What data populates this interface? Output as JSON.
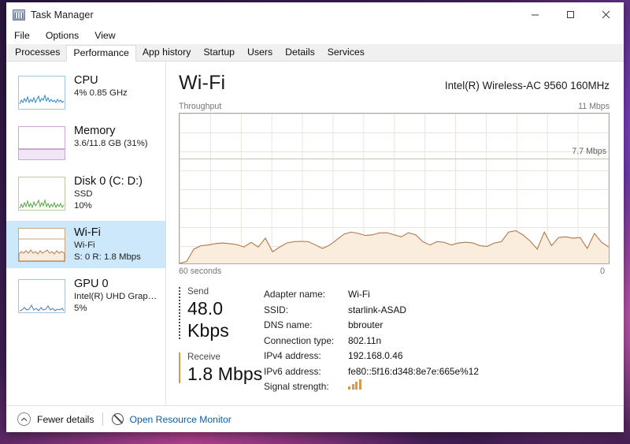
{
  "window": {
    "title": "Task Manager",
    "icon": "task-manager-icon",
    "controls": {
      "minimize": "minimize-icon",
      "maximize": "maximize-icon",
      "close": "close-icon"
    }
  },
  "menu": {
    "items": [
      "File",
      "Options",
      "View"
    ]
  },
  "tabs": {
    "active": "Performance",
    "items": [
      "Processes",
      "Performance",
      "App history",
      "Startup",
      "Users",
      "Details",
      "Services"
    ]
  },
  "sidebar": {
    "items": [
      {
        "title": "CPU",
        "sub1": "4%  0.85 GHz",
        "sub2": "",
        "color": "#1f7fc4",
        "selected": false
      },
      {
        "title": "Memory",
        "sub1": "3.6/11.8 GB (31%)",
        "sub2": "",
        "color": "#a55fa5",
        "selected": false
      },
      {
        "title": "Disk 0 (C: D:)",
        "sub1": "SSD",
        "sub2": "10%",
        "color": "#4a9d3f",
        "selected": false
      },
      {
        "title": "Wi-Fi",
        "sub1": "Wi-Fi",
        "sub2": "S: 0 R: 1.8 Mbps",
        "color": "#c8803a",
        "selected": true
      },
      {
        "title": "GPU 0",
        "sub1": "Intel(R) UHD Graphics ...",
        "sub2": "5%",
        "color": "#3b7cb5",
        "selected": false
      }
    ]
  },
  "main": {
    "title": "Wi-Fi",
    "adapter": "Intel(R) Wireless-AC 9560 160MHz",
    "graph_caption": "Throughput",
    "scale_max": "11 Mbps",
    "peak_label": "7.7 Mbps",
    "time_left": "60 seconds",
    "time_right": "0"
  },
  "rates": {
    "send": {
      "label": "Send",
      "value": "48.0 Kbps"
    },
    "receive": {
      "label": "Receive",
      "value": "1.8 Mbps"
    }
  },
  "details": {
    "rows": [
      {
        "key": "Adapter name:",
        "value": "Wi-Fi"
      },
      {
        "key": "SSID:",
        "value": "starlink-ASAD"
      },
      {
        "key": "DNS name:",
        "value": "bbrouter"
      },
      {
        "key": "Connection type:",
        "value": "802.11n"
      },
      {
        "key": "IPv4 address:",
        "value": "192.168.0.46"
      },
      {
        "key": "IPv6 address:",
        "value": "fe80::5f16:d348:8e7e:665e%12"
      },
      {
        "key": "Signal strength:",
        "value": "",
        "icon": "signal-bars-icon"
      }
    ]
  },
  "footer": {
    "fewer_details": "Fewer details",
    "resource_monitor": "Open Resource Monitor"
  },
  "colors": {
    "accent_wifi": "#d79b45",
    "chart_fill": "#fbeddd",
    "chart_stroke": "#b07a4a",
    "selection": "#cde8fa",
    "link": "#0a5fa8"
  },
  "chart_data": {
    "type": "area",
    "title": "Throughput",
    "ylabel": "Mbps",
    "xlabel": "seconds",
    "ylim": [
      0,
      11
    ],
    "xlim": [
      60,
      0
    ],
    "grid": true,
    "peak_annotation": 7.7,
    "x": [
      0,
      1,
      2,
      3,
      4,
      5,
      6,
      7,
      8,
      9,
      10,
      11,
      12,
      13,
      14,
      15,
      16,
      17,
      18,
      19,
      20,
      21,
      22,
      23,
      24,
      25,
      26,
      27,
      28,
      29,
      30,
      31,
      32,
      33,
      34,
      35,
      36,
      37,
      38,
      39,
      40,
      41,
      42,
      43,
      44,
      45,
      46,
      47,
      48,
      49,
      50,
      51,
      52,
      53,
      54,
      55,
      56,
      57,
      58,
      59,
      60
    ],
    "values": [
      0.0,
      0.15,
      1.05,
      1.3,
      1.35,
      1.45,
      1.5,
      1.45,
      1.38,
      1.2,
      1.55,
      1.2,
      1.85,
      0.85,
      1.2,
      1.5,
      1.6,
      1.62,
      1.6,
      1.35,
      1.1,
      1.35,
      1.75,
      2.15,
      2.3,
      2.2,
      2.05,
      2.1,
      2.25,
      2.25,
      2.1,
      1.95,
      2.25,
      2.1,
      1.6,
      1.35,
      1.6,
      1.55,
      1.35,
      1.5,
      1.55,
      1.5,
      1.3,
      1.25,
      1.5,
      1.6,
      2.3,
      2.4,
      2.1,
      1.65,
      1.05,
      2.3,
      1.3,
      1.9,
      1.95,
      1.85,
      1.9,
      1.1,
      2.2,
      1.55,
      1.2
    ]
  }
}
